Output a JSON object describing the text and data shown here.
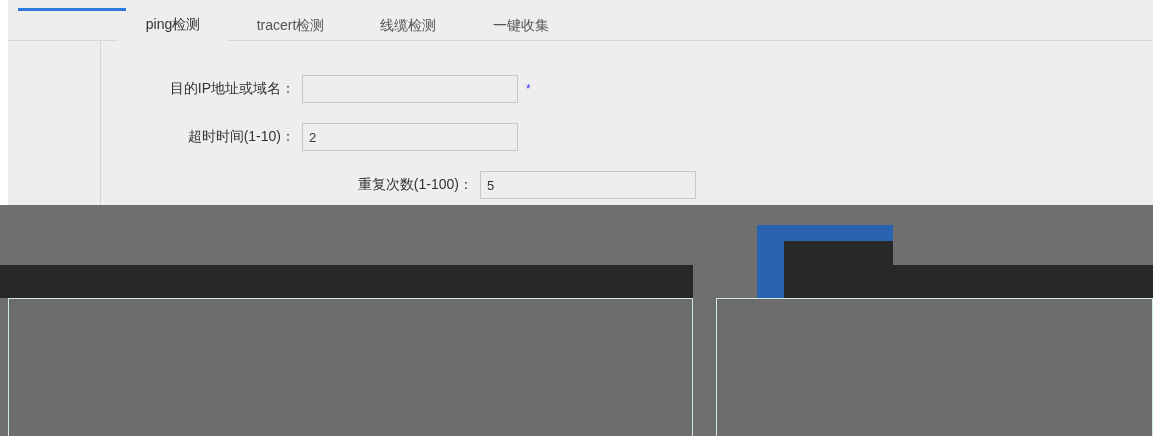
{
  "tabs": [
    {
      "label": "ping检测",
      "selected": true
    },
    {
      "label": "tracert检测",
      "selected": false
    },
    {
      "label": "线缆检测",
      "selected": false
    },
    {
      "label": "一键收集",
      "selected": false
    }
  ],
  "form": {
    "fields": [
      {
        "label": "目的IP地址或域名：",
        "required": true
      },
      {
        "label": "超时时间(1-10)：",
        "value": "2",
        "required": false
      },
      {
        "label": "重复次数(1-100)：",
        "value": "5",
        "required": false
      }
    ],
    "required_mark": "*"
  }
}
